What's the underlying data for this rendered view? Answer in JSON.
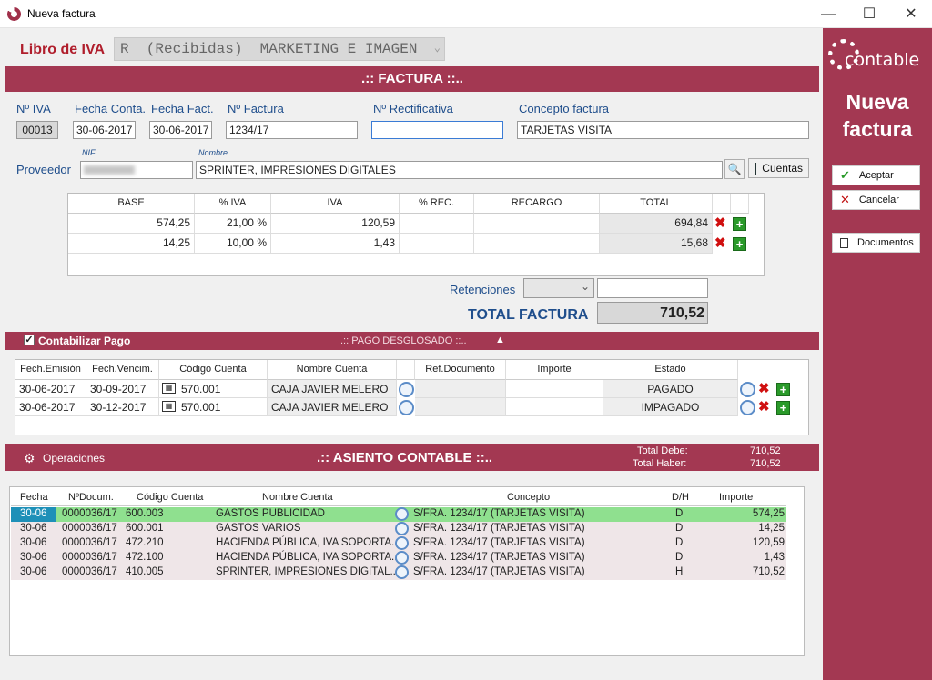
{
  "window": {
    "title": "Nueva factura",
    "min": "—",
    "max": "☐",
    "close": "✕"
  },
  "libro": {
    "label": "Libro de IVA",
    "value": "R  (Recibidas)  MARKETING E IMAGEN"
  },
  "factura_band": ".:: FACTURA ::..",
  "labels": {
    "n_iva": "Nº IVA",
    "fecha_conta": "Fecha Conta.",
    "fecha_fact": "Fecha Fact.",
    "n_factura": "Nº Factura",
    "n_rectificativa": "Nº Rectificativa",
    "concepto": "Concepto factura",
    "proveedor": "Proveedor",
    "nif": "NIF",
    "nombre": "Nombre",
    "retenciones": "Retenciones",
    "total_factura": "TOTAL FACTURA"
  },
  "values": {
    "n_iva": "00013",
    "fecha_conta": "30-06-2017",
    "fecha_fact": "30-06-2017",
    "n_factura": "1234/17",
    "n_rectificativa": "",
    "concepto": "TARJETAS VISITA",
    "nif": "",
    "nombre": "SPRINTER, IMPRESIONES DIGITALES",
    "total_factura": "710,52",
    "retenciones_value": ""
  },
  "buttons": {
    "cuentas": "Cuentas",
    "aceptar": "Aceptar",
    "cancelar": "Cancelar",
    "documentos": "Documentos"
  },
  "iva_table": {
    "headers": [
      "BASE",
      "% IVA",
      "IVA",
      "% REC.",
      "RECARGO",
      "TOTAL"
    ],
    "rows": [
      [
        "574,25",
        "21,00 %",
        "120,59",
        "",
        "",
        "694,84"
      ],
      [
        "14,25",
        "10,00 %",
        "1,43",
        "",
        "",
        "15,68"
      ]
    ]
  },
  "pago": {
    "check_label": "Contabilizar Pago",
    "band": ".:: PAGO DESGLOSADO ::..",
    "arrow": "▲",
    "headers": [
      "Fech.Emisión",
      "Fech.Vencim.",
      "Código Cuenta",
      "Nombre Cuenta",
      "Ref.Documento",
      "Importe",
      "Estado"
    ],
    "rows": [
      [
        "30-06-2017",
        "30-09-2017",
        "570.001",
        "CAJA JAVIER MELERO",
        "",
        "",
        "PAGADO"
      ],
      [
        "30-06-2017",
        "30-12-2017",
        "570.001",
        "CAJA JAVIER MELERO",
        "",
        "",
        "IMPAGADO"
      ]
    ]
  },
  "asiento": {
    "operaciones": "Operaciones",
    "band": ".:: ASIENTO CONTABLE ::..",
    "total_debe_label": "Total Debe:",
    "total_debe": "710,52",
    "total_haber_label": "Total Haber:",
    "total_haber": "710,52",
    "headers": [
      "Fecha",
      "NºDocum.",
      "Código Cuenta",
      "Nombre Cuenta",
      "Concepto",
      "D/H",
      "Importe"
    ],
    "rows": [
      [
        "30-06",
        "0000036/17",
        "600.003",
        "GASTOS PUBLICIDAD",
        "S/FRA. 1234/17 (TARJETAS VISITA)",
        "D",
        "574,25"
      ],
      [
        "30-06",
        "0000036/17",
        "600.001",
        "GASTOS VARIOS",
        "S/FRA. 1234/17 (TARJETAS VISITA)",
        "D",
        "14,25"
      ],
      [
        "30-06",
        "0000036/17",
        "472.210",
        "HACIENDA PÚBLICA, IVA SOPORTA...",
        "S/FRA. 1234/17 (TARJETAS VISITA)",
        "D",
        "120,59"
      ],
      [
        "30-06",
        "0000036/17",
        "472.100",
        "HACIENDA PÚBLICA, IVA SOPORTA...",
        "S/FRA. 1234/17 (TARJETAS VISITA)",
        "D",
        "1,43"
      ],
      [
        "30-06",
        "0000036/17",
        "410.005",
        "SPRINTER, IMPRESIONES DIGITAL...",
        "S/FRA. 1234/17 (TARJETAS VISITA)",
        "H",
        "710,52"
      ]
    ]
  },
  "sidebar": {
    "brand": "contable",
    "title_line1": "Nueva",
    "title_line2": "factura"
  },
  "colors": {
    "accent": "#a33852",
    "label_blue": "#1f4e8c",
    "selected_row": "#8fe08f"
  }
}
